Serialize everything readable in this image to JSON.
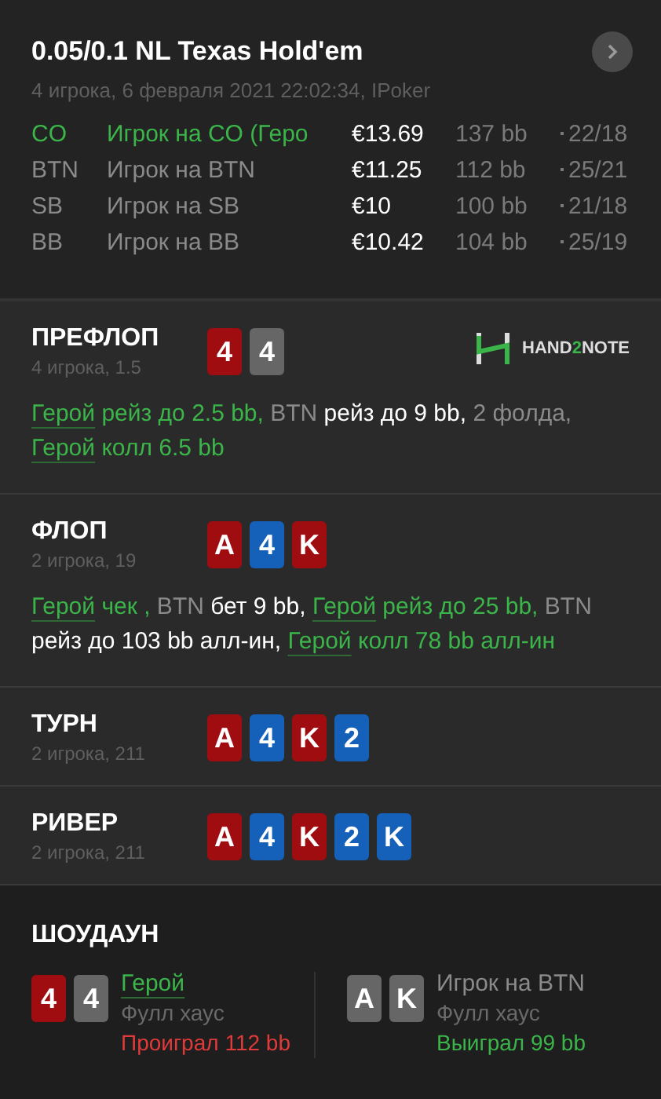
{
  "header": {
    "title": "0.05/0.1 NL Texas Hold'em",
    "subtitle": "4 игрока, 6 февраля 2021 22:02:34, IPoker"
  },
  "players": [
    {
      "position": "CO",
      "name": "Игрок на CO (Геро",
      "hero": true,
      "stack": "€13.69",
      "bb": "137 bb",
      "stats": "22/18"
    },
    {
      "position": "BTN",
      "name": "Игрок на BTN",
      "hero": false,
      "stack": "€11.25",
      "bb": "112 bb",
      "stats": "25/21"
    },
    {
      "position": "SB",
      "name": "Игрок на SB",
      "hero": false,
      "stack": "€10",
      "bb": "100 bb",
      "stats": "21/18"
    },
    {
      "position": "BB",
      "name": "Игрок на BB",
      "hero": false,
      "stack": "€10.42",
      "bb": "104 bb",
      "stats": "25/19"
    }
  ],
  "streets": [
    {
      "title": "ПРЕФЛОП",
      "subtitle": "4 игрока, 1.5",
      "logo": [
        "HAND",
        "2",
        "NOTE"
      ],
      "cards": [
        {
          "rank": "4",
          "color": "#a00d10"
        },
        {
          "rank": "4",
          "color": "#666666"
        }
      ],
      "actions": [
        {
          "kind": "hero",
          "text": "Герой"
        },
        {
          "kind": "hero-action",
          "text": " рейз до 2.5 bb,"
        },
        {
          "kind": "player",
          "text": " BTN"
        },
        {
          "kind": "action",
          "text": " рейз до 9 bb,"
        },
        {
          "kind": "player",
          "text": " 2 фолда, "
        },
        {
          "kind": "hero",
          "text": "Герой"
        },
        {
          "kind": "hero-action",
          "text": " колл 6.5 bb"
        }
      ]
    },
    {
      "title": "ФЛОП",
      "subtitle": "2 игрока, 19",
      "cards": [
        {
          "rank": "A",
          "color": "#a00d10"
        },
        {
          "rank": "4",
          "color": "#1560b8"
        },
        {
          "rank": "K",
          "color": "#a00d10"
        }
      ],
      "actions": [
        {
          "kind": "hero",
          "text": "Герой"
        },
        {
          "kind": "hero-action",
          "text": " чек ,"
        },
        {
          "kind": "player",
          "text": " BTN"
        },
        {
          "kind": "action",
          "text": " бет 9 bb, "
        },
        {
          "kind": "hero",
          "text": "Герой"
        },
        {
          "kind": "hero-action",
          "text": " рейз до 25 bb,"
        },
        {
          "kind": "player",
          "text": " BTN"
        },
        {
          "kind": "action",
          "text": " рейз до 103 bb алл-ин, "
        },
        {
          "kind": "hero",
          "text": "Герой"
        },
        {
          "kind": "hero-action",
          "text": " колл 78 bb алл-ин"
        }
      ]
    },
    {
      "title": "ТУРН",
      "subtitle": "2 игрока, 211",
      "cards": [
        {
          "rank": "A",
          "color": "#a00d10"
        },
        {
          "rank": "4",
          "color": "#1560b8"
        },
        {
          "rank": "K",
          "color": "#a00d10"
        },
        {
          "rank": "2",
          "color": "#1560b8"
        }
      ]
    },
    {
      "title": "РИВЕР",
      "subtitle": "2 игрока, 211",
      "cards": [
        {
          "rank": "A",
          "color": "#a00d10"
        },
        {
          "rank": "4",
          "color": "#1560b8"
        },
        {
          "rank": "K",
          "color": "#a00d10"
        },
        {
          "rank": "2",
          "color": "#1560b8"
        },
        {
          "rank": "K",
          "color": "#1560b8"
        }
      ]
    }
  ],
  "showdown": {
    "title": "ШОУДАУН",
    "players": [
      {
        "name": "Герой",
        "hero": true,
        "hand": "Фулл хаус",
        "result": "Проиграл 112 bb",
        "won": false,
        "cards": [
          {
            "rank": "4",
            "color": "#a00d10"
          },
          {
            "rank": "4",
            "color": "#666666"
          }
        ]
      },
      {
        "name": "Игрок на BTN",
        "hero": false,
        "hand": "Фулл хаус",
        "result": "Выиграл 99 bb",
        "won": true,
        "cards": [
          {
            "rank": "A",
            "color": "#666666"
          },
          {
            "rank": "K",
            "color": "#666666"
          }
        ]
      }
    ]
  }
}
